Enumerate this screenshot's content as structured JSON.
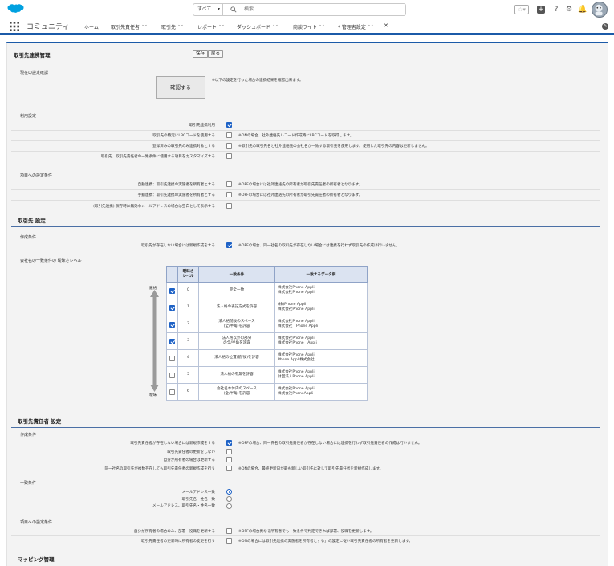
{
  "header": {
    "search_scope": "すべて",
    "search_placeholder": "検索..."
  },
  "nav": {
    "app_name": "コミュニティ",
    "items": [
      {
        "label": "ホーム",
        "has_chevron": false
      },
      {
        "label": "取引先責任者",
        "has_chevron": true
      },
      {
        "label": "取引先",
        "has_chevron": true
      },
      {
        "label": "レポート",
        "has_chevron": true
      },
      {
        "label": "ダッシュボード",
        "has_chevron": true
      },
      {
        "label": "商談ライト",
        "has_chevron": true
      },
      {
        "label": "* 管理者設定",
        "has_chevron": true
      }
    ]
  },
  "page": {
    "title": "取引先連携管理",
    "save_label": "保存",
    "back_label": "戻る"
  },
  "status_section": {
    "heading": "現在の設定確認",
    "confirm_label": "確認する",
    "confirm_note": "※以下の設定を行った場合の連携結果を確認出来ます。"
  },
  "usage_section": {
    "heading": "利用設定",
    "rows": [
      {
        "label": "取引先連携利用",
        "checked": true,
        "note": ""
      },
      {
        "label": "取引先の特定にLBCコードを使用する",
        "checked": false,
        "note": "※ONの場合、社外連絡先レコード作成時にLBCコードを取得します。"
      },
      {
        "label": "登録済みの取引先のみ連携対象とする",
        "checked": false,
        "note": "※取引先の取引先名と社外連絡先の会社名が一致する取引先を使用します。使用した取引先の内容は更新しません。"
      },
      {
        "label": "取引先、取引先責任者の一致条件に使用する項目をカスタマイズする",
        "checked": false,
        "note": ""
      }
    ]
  },
  "item_section": {
    "heading": "項目への設定条件",
    "rows": [
      {
        "label": "自動連携：取引先連携の実施者を所有者とする",
        "checked": false,
        "note": "※OFFの場合には社外連絡先の所有者が取引先責任者の所有者となります。"
      },
      {
        "label": "手動連携：取引先連携の実施者を所有者とする",
        "checked": false,
        "note": "※OFFの場合には社外連絡先の所有者が取引先責任者の所有者となります。"
      },
      {
        "label": "(取引先連携) 保存時に無効なメールアドレスの場合は空白として表示する",
        "checked": false,
        "note": ""
      }
    ]
  },
  "account_settings": {
    "title": "取引先 設定",
    "create_heading": "作成条件",
    "create_label": "取引先が存在しない場合には新規作成をする",
    "create_checked": true,
    "create_note": "※OFFの場合、同一社名の取引先が存在しない場合には連携を行わず取引先の作成は行いません。",
    "fuzzy_heading": "会社名の一致条件の 曖昧さレベル",
    "strict_label": "厳格",
    "loose_label": "曖昧",
    "table_headers": {
      "level": "曖昧さ\nレベル",
      "condition": "一致条件",
      "example": "一致するデータ例"
    },
    "rows": [
      {
        "checked": true,
        "level": "0",
        "condition": "完全一致",
        "example": "株式会社Phone Appli\n株式会社Phone Appli"
      },
      {
        "checked": true,
        "level": "1",
        "condition": "法人格の表記方式を許容",
        "example": "(株)Phone Appli\n株式会社Phone Appli"
      },
      {
        "checked": true,
        "level": "2",
        "condition": "法人格前後のスペース\n(全/半角)を許容",
        "example": "株式会社Phone Appli\n株式会社　Phone Appli"
      },
      {
        "checked": true,
        "level": "3",
        "condition": "法人格以外の部分\nの全/半角を許容",
        "example": "株式会社Phone Appli\n株式会社Phone　Appli"
      },
      {
        "checked": false,
        "level": "4",
        "condition": "法人格の位置(前/後)を許容",
        "example": "株式会社Phone Appli\nPhone Appli株式会社"
      },
      {
        "checked": false,
        "level": "5",
        "condition": "法人格の有無を許容",
        "example": "株式会社Phone Appli\n財団法人Phone Appli"
      },
      {
        "checked": false,
        "level": "6",
        "condition": "会社名本体内のスペース\n(全/半角)を許容",
        "example": "株式会社Phone Appli\n株式会社PhoneAppli"
      }
    ]
  },
  "contact_settings": {
    "title": "取引先責任者 設定",
    "create_heading": "作成条件",
    "create_rows": [
      {
        "label": "取引先責任者が存在しない場合には新規作成をする",
        "checked": true,
        "note": "※OFFの場合、同一氏名の取引先責任者が存在しない場合には連携を行わず取引先責任者の作成は行いません。"
      },
      {
        "label": "取引先責任者の更新をしない",
        "checked": false,
        "note": ""
      },
      {
        "label": "自分が所有者の場合は更新する",
        "checked": false,
        "note": ""
      },
      {
        "label": "同一社名の取引先が複数存在しても取引先責任者の新規作成を行う",
        "checked": false,
        "note": "※ONの場合、最終更新日が最も新しい取引先に対して取引先責任者を新規作成します。"
      }
    ],
    "match_heading": "一致条件",
    "match_rows": [
      {
        "label": "メールアドレス一致",
        "selected": true
      },
      {
        "label": "取引先名・姓名一致",
        "selected": false
      },
      {
        "label": "メールアドレス、取引先名・姓名一致",
        "selected": false
      }
    ],
    "item_heading": "項目への設定条件",
    "item_rows": [
      {
        "label": "自分が所有者の場合のみ、部署・役職を更新する",
        "checked": false,
        "note": "※OFFの場合異なる所有者でも一致条件で判定できれば部署、役職を更新します。"
      },
      {
        "label": "取引先責任者の更新時に所有者の変更を行う",
        "checked": false,
        "note": "※ONの場合には取引先連携の実施者を所有者とする」の設定に従い取引先責任者の所有者を更新します。"
      }
    ]
  },
  "mapping": {
    "title": "マッピング管理"
  }
}
